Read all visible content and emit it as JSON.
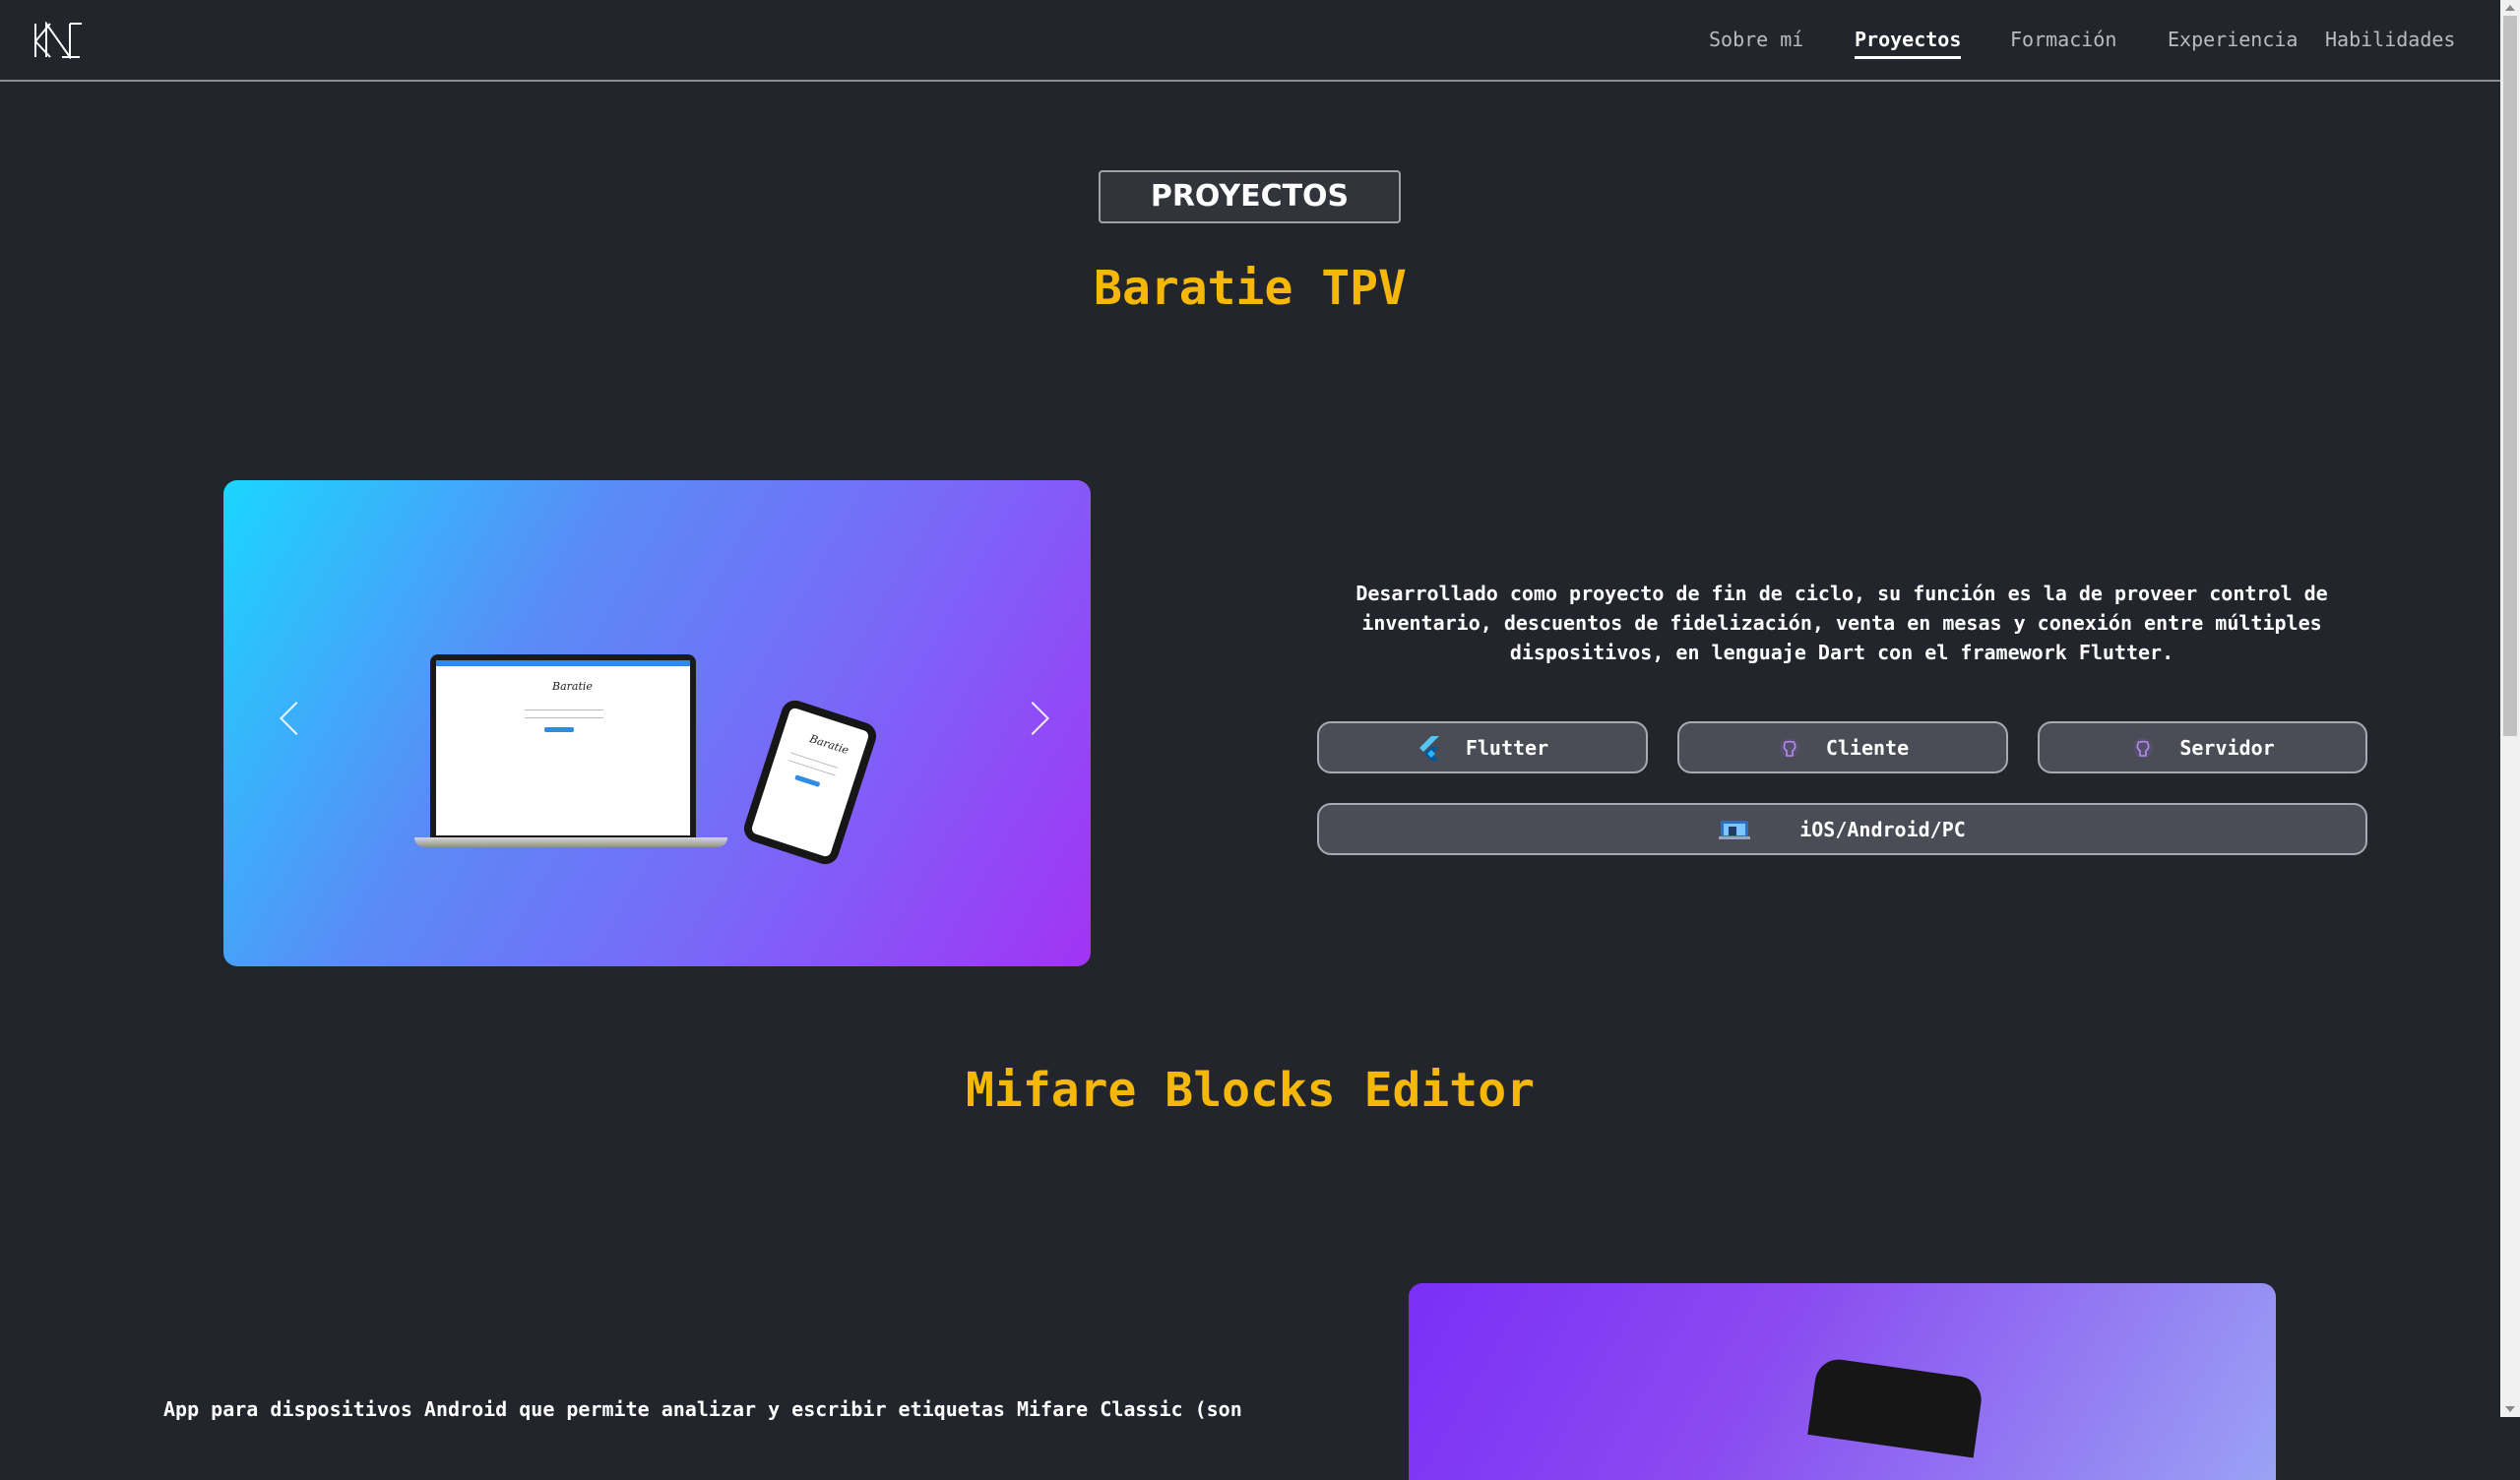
{
  "nav": {
    "logo_text": "KN",
    "items": [
      {
        "label": "Sobre mí",
        "active": false
      },
      {
        "label": "Proyectos",
        "active": true
      },
      {
        "label": "Formación",
        "active": false
      },
      {
        "label": "Experiencia",
        "active": false
      },
      {
        "label": "Habilidades",
        "active": false
      }
    ]
  },
  "section": {
    "badge": "PROYECTOS"
  },
  "projects": [
    {
      "title": "Baratie TPV",
      "description": "Desarrollado como proyecto de fin de ciclo, su función es la de proveer control de inventario, descuentos de fidelización, venta en mesas y conexión entre múltiples dispositivos, en lenguaje Dart con el framework Flutter.",
      "screenshot_brand": "Baratie",
      "tags": [
        {
          "label": "Flutter",
          "icon": "flutter-icon"
        },
        {
          "label": "Cliente",
          "icon": "github-icon"
        },
        {
          "label": "Servidor",
          "icon": "github-icon"
        },
        {
          "label": "iOS/Android/PC",
          "icon": "devices-icon"
        }
      ]
    },
    {
      "title": "Mifare Blocks Editor",
      "description": "App para dispositivos Android que permite analizar y escribir etiquetas Mifare Classic (son"
    }
  ],
  "colors": {
    "background": "#23252d",
    "accent_title": "#f5b80a",
    "button_bg": "#4a4d55"
  }
}
